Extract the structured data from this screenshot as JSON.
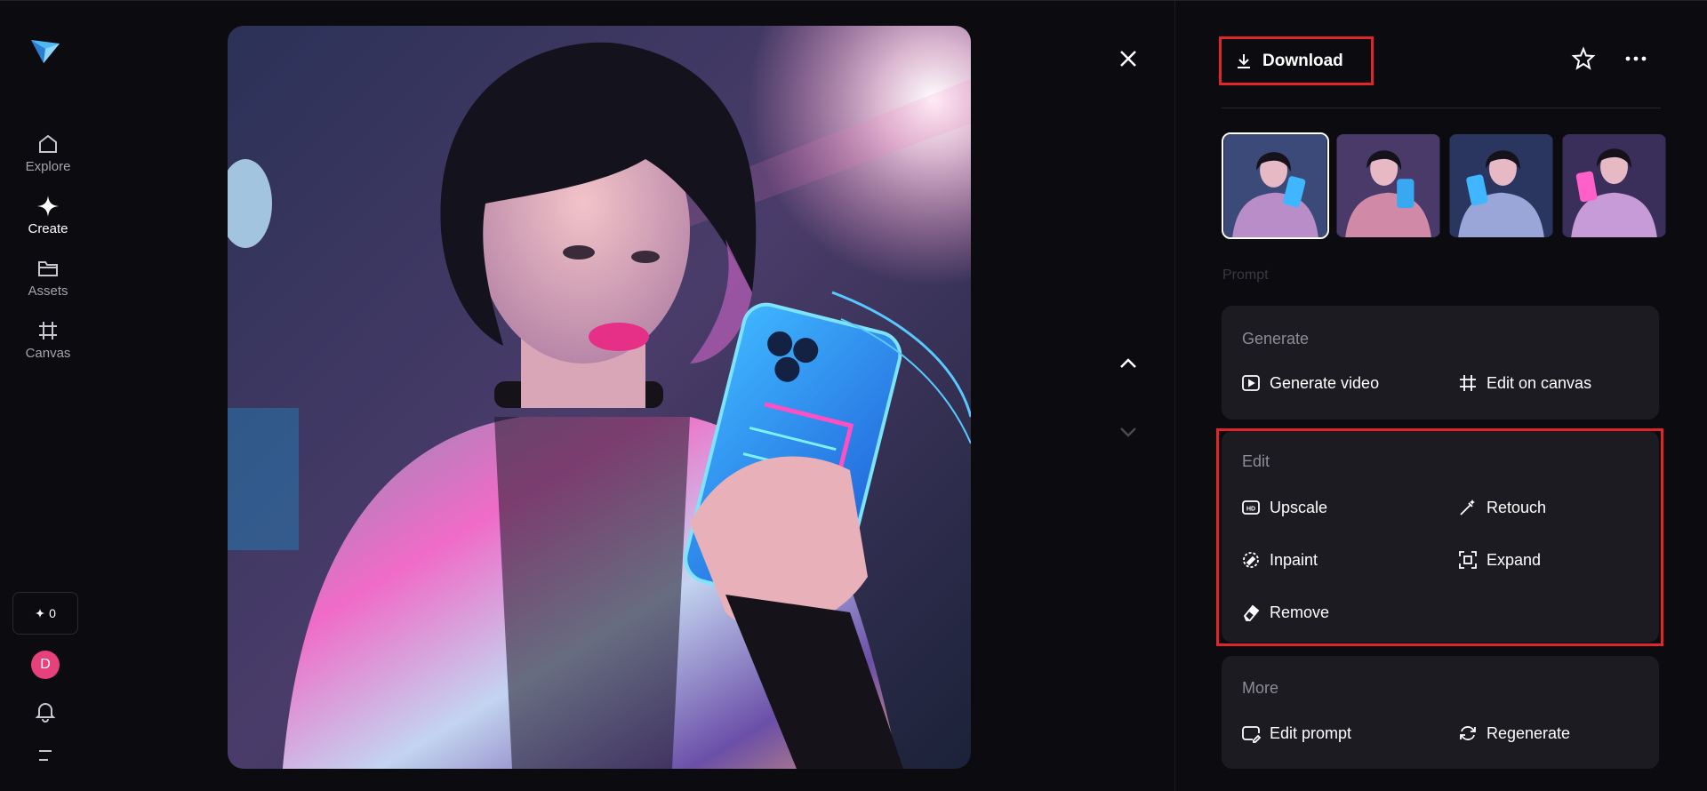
{
  "sidebar": {
    "items": [
      {
        "label": "Explore",
        "icon": "home-icon"
      },
      {
        "label": "Create",
        "icon": "sparkle-icon"
      },
      {
        "label": "Assets",
        "icon": "folder-icon"
      },
      {
        "label": "Canvas",
        "icon": "canvas-icon"
      }
    ],
    "credits": "0",
    "avatar_initial": "D"
  },
  "panel": {
    "download_label": "Download",
    "prompt_label": "Prompt",
    "generate": {
      "title": "Generate",
      "actions": [
        "Generate video",
        "Edit on canvas"
      ]
    },
    "edit": {
      "title": "Edit",
      "actions": [
        "Upscale",
        "Retouch",
        "Inpaint",
        "Expand",
        "Remove"
      ]
    },
    "more": {
      "title": "More",
      "actions": [
        "Edit prompt",
        "Regenerate"
      ]
    }
  },
  "colors": {
    "highlight": "#e0262b",
    "avatar": "#e6417a",
    "card_bg": "#1c1b21",
    "background": "#0c0b0f"
  }
}
